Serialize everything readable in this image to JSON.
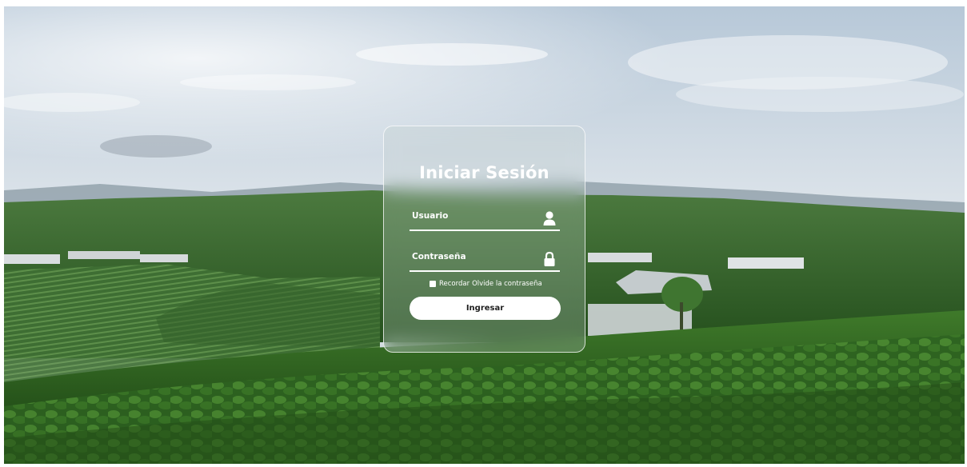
{
  "login": {
    "title": "Iniciar Sesión",
    "username_label": "Usuario",
    "password_label": "Contraseña",
    "remember_label": "Recordar",
    "forgot_label": "Olvide la contraseña",
    "submit_label": "Ingresar"
  },
  "icons": {
    "user": "user-icon",
    "lock": "lock-icon"
  },
  "colors": {
    "text": "#ffffff",
    "button_bg": "#ffffff",
    "button_text": "#1e1e1e",
    "card_border": "#ffffff"
  }
}
